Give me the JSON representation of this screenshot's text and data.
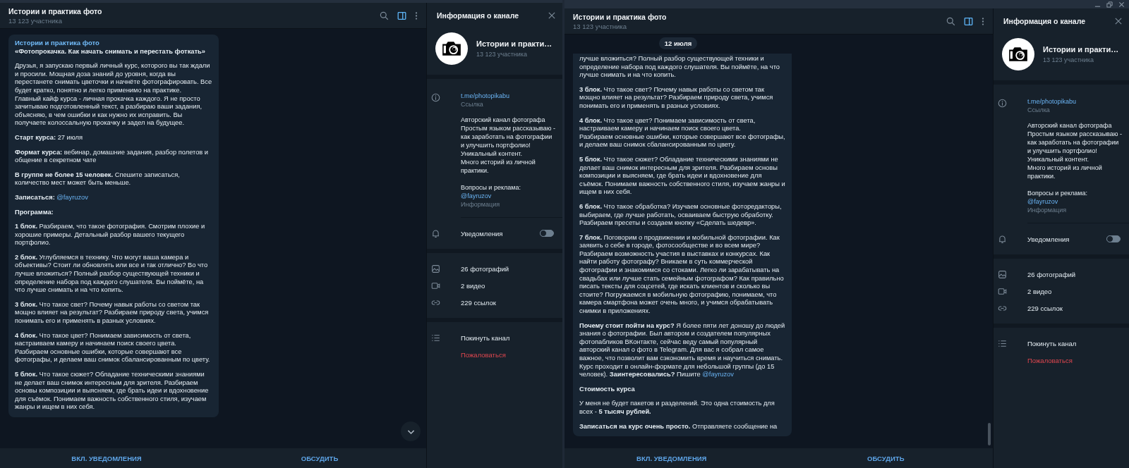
{
  "windows": [
    {
      "titlebar": {
        "window_controls": false
      },
      "chat": {
        "title": "Истории и практика фото",
        "subtitle": "13 123 участника",
        "info_toggle_selected": true
      },
      "message": {
        "author": "Истории и практика фото",
        "paragraphs": [
          {
            "kind": "heading",
            "text": "«Фотопрокачка. Как начать снимать и перестать фоткать»"
          },
          {
            "kind": "text",
            "text": "Друзья, я запускаю первый личный курс, которого вы так ждали и просили. Мощная доза знаний до уровня, когда вы перестанете снимать цветочки и начнёте фотографировать. Все будет кратко, понятно и легко применимо на практике.\nГлавный кайф курса - личная прокачка каждого. Я не просто зачитываю подготовленный текст, а разбираю ваши задания, объясняю, в чем ошибки и как нужно их исправить. Вы получаете колоссальную прокачку и задел на будущее."
          },
          {
            "kind": "text",
            "text": "**Старт курса:** 27 июля"
          },
          {
            "kind": "text",
            "text": "**Формат курса:** вебинар, домашние задания, разбор полетов и общение в секретном чате"
          },
          {
            "kind": "text",
            "text": "**В группе не более 15 человек.** Спешите записаться, количество мест может быть меньше."
          },
          {
            "kind": "text",
            "text": "**Записаться:** ",
            "mention": "@fayruzov"
          },
          {
            "kind": "heading",
            "text": "Программа:"
          },
          {
            "kind": "text",
            "text": "**1 блок.** Разбираем, что такое фотография. Смотрим плохие и хорошие примеры. Детальный разбор вашего текущего портфолио."
          },
          {
            "kind": "text",
            "text": "**2 блок.** Углубляемся в технику. Что могут ваша камера и объективы? Стоит ли обновлять или все и так отлично? Во что лучше вложиться? Полный разбор существующей техники и определение набора под каждого слушателя. Вы поймёте, на что лучше снимать и на что копить."
          },
          {
            "kind": "text",
            "text": "**3 блок.** Что такое свет? Почему навык работы со светом так мощно влияет на результат? Разбираем природу света, учимся понимать его и применять в разных условиях."
          },
          {
            "kind": "text",
            "text": "**4 блок.** Что такое цвет? Понимаем зависимость от света, настраиваем камеру и начинаем поиск своего цвета.\nРазбираем основные ошибки, которые совершают все фотографы, и делаем ваш снимок сбалансированным по цвету."
          },
          {
            "kind": "text",
            "text": "**5 блок.** Что такое сюжет? Обладание техническими знаниями не делает ваш снимок интересным для зрителя. Разбираем основы композиции и выясняем, где брать идеи и вдохновение для съёмок. Понимаем важность собственного стиля, изучаем жанры и ищем в них себя."
          }
        ]
      },
      "scroll_down_button": true,
      "scrollbar": false,
      "footer_buttons": [
        "ВКЛ. УВЕДОМЛЕНИЯ",
        "ОБСУДИТЬ"
      ],
      "info": {
        "title": "Информация о канале",
        "name": "Истории и практи…",
        "members": "13 123 участника",
        "link": "t.me/photopikabu",
        "link_label": "Ссылка",
        "description": "Авторский канал фотографа\nПростым языком рассказываю - как заработать на фотографии и улучшить портфолио!\nУникальный контент.\nМного историй из личной практики.",
        "contact_label": "Вопросы и реклама:",
        "contact": "@fayruzov",
        "description_label": "Информация",
        "notifications": {
          "label": "Уведомления",
          "on": false
        },
        "media": [
          {
            "kind": "photos",
            "label": "26 фотографий"
          },
          {
            "kind": "videos",
            "label": "2 видео"
          },
          {
            "kind": "links",
            "label": "229 ссылок"
          }
        ],
        "actions": [
          {
            "kind": "leave",
            "label": "Покинуть канал"
          },
          {
            "kind": "report",
            "label": "Пожаловаться"
          }
        ]
      }
    },
    {
      "titlebar": {
        "window_controls": true
      },
      "chat": {
        "title": "Истории и практика фото",
        "subtitle": "13 123 участника",
        "info_toggle_selected": true
      },
      "date_badge": "12 июля",
      "message": {
        "paragraphs": [
          {
            "kind": "text",
            "text": "лучше вложиться? Полный разбор существующей техники и определение набора под каждого слушателя. Вы поймёте, на что лучше снимать и на что копить."
          },
          {
            "kind": "text",
            "text": "**3 блок.** Что такое свет? Почему навык работы со светом так мощно влияет на результат? Разбираем природу света, учимся понимать его и применять в разных условиях."
          },
          {
            "kind": "text",
            "text": "**4 блок.** Что такое цвет? Понимаем зависимость от света, настраиваем камеру и начинаем поиск своего цвета.\nРазбираем основные ошибки, которые совершают все фотографы, и делаем ваш снимок сбалансированным по цвету."
          },
          {
            "kind": "text",
            "text": "**5 блок.** Что такое сюжет? Обладание техническими знаниями не делает ваш снимок интересным для зрителя. Разбираем основы композиции и выясняем, где брать идеи и вдохновение для съёмок. Понимаем важность собственного стиля, изучаем жанры и ищем в них себя."
          },
          {
            "kind": "text",
            "text": "**6 блок.** Что такое обработка? Изучаем основные фоторедакторы, выбираем, где лучше работать, осваиваем быструю обработку. Разбираем пресеты и создаем кнопку «Сделать шедевр»."
          },
          {
            "kind": "text",
            "text": "**7 блок.** Поговорим о продвижении и мобильной фотографии. Как заявить о себе в городе, фотосообществе и во всем мире? Разбираем возможность участия в выставках и конкурсах. Как найти работу фотографу? Вникаем в суть коммерческой фотографии и знакомимся со стоками. Легко ли зарабатывать на свадьбах или лучше стать семейным фотографом? Как правильно писать тексты для соцсетей, где искать клиентов и сколько вы стоите? Погружаемся в мобильную фотографию, понимаем, что камера смартфона может очень много, и учимся обрабатывать снимки в приложениях."
          },
          {
            "kind": "text",
            "text": "**Почему стоит пойти на курс?** Я более пяти лет доношу до людей знания о фотографии. Был автором и создателем популярных фотопабликов ВКонтакте, сейчас веду самый популярный авторский канал о фото в Telegram. Для вас я собрал самое важное, что позволит вам сэкономить время и научиться снимать. Курс проходит в онлайн-формате для небольшой группы (до 15 человек). **Заинтересовались?** Пишите ",
            "mention": "@fayruzov"
          },
          {
            "kind": "heading",
            "text": "Стоимость курса"
          },
          {
            "kind": "text",
            "text": "У меня не будет пакетов и разделений. Это одна стоимость для всех - **5 тысяч рублей.**"
          },
          {
            "kind": "text",
            "text": "**Записаться на курс очень просто.** Отправляете сообщение на"
          }
        ]
      },
      "scroll_down_button": false,
      "scrollbar": true,
      "footer_buttons": [
        "ВКЛ. УВЕДОМЛЕНИЯ",
        "ОБСУДИТЬ"
      ],
      "info": {
        "title": "Информация о канале",
        "name": "Истории и практи…",
        "members": "13 123 участника",
        "link": "t.me/photopikabu",
        "link_label": "Ссылка",
        "description": "Авторский канал фотографа\nПростым языком рассказываю - как заработать на фотографии и улучшить портфолио!\nУникальный контент.\nМного историй из личной практики.",
        "contact_label": "Вопросы и реклама:",
        "contact": "@fayruzov",
        "description_label": "Информация",
        "notifications": {
          "label": "Уведомления",
          "on": false
        },
        "media": [
          {
            "kind": "photos",
            "label": "26 фотографий"
          },
          {
            "kind": "videos",
            "label": "2 видео"
          },
          {
            "kind": "links",
            "label": "229 ссылок"
          }
        ],
        "actions": [
          {
            "kind": "leave",
            "label": "Покинуть канал"
          },
          {
            "kind": "report",
            "label": "Пожаловаться"
          }
        ]
      }
    }
  ]
}
